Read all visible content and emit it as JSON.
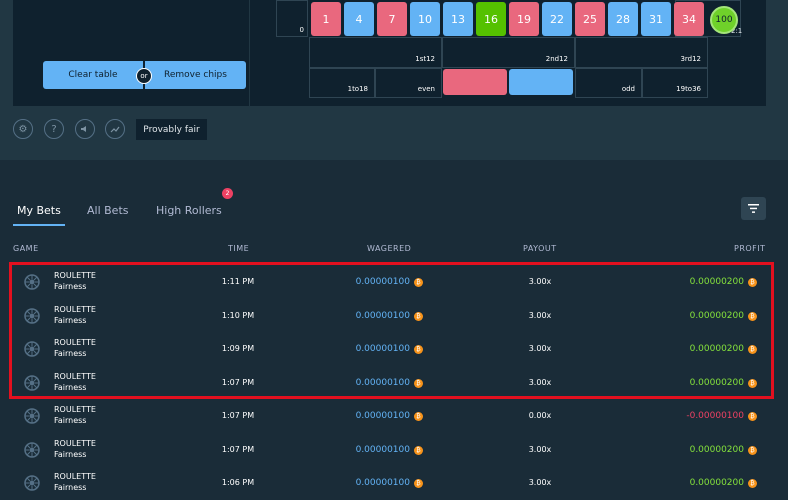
{
  "controls": {
    "clear_table": "Clear table",
    "or": "or",
    "remove_chips": "Remove chips",
    "provably_fair": "Provably fair"
  },
  "board": {
    "zero": "0",
    "numbers": [
      {
        "value": "1",
        "color": "red"
      },
      {
        "value": "4",
        "color": "blue"
      },
      {
        "value": "7",
        "color": "red"
      },
      {
        "value": "10",
        "color": "blue"
      },
      {
        "value": "13",
        "color": "blue"
      },
      {
        "value": "16",
        "color": "green"
      },
      {
        "value": "19",
        "color": "red"
      },
      {
        "value": "22",
        "color": "blue"
      },
      {
        "value": "25",
        "color": "red"
      },
      {
        "value": "28",
        "color": "blue"
      },
      {
        "value": "31",
        "color": "blue"
      },
      {
        "value": "34",
        "color": "red"
      }
    ],
    "column_suffix": "2:1",
    "dozens": [
      "1st12",
      "2nd12",
      "3rd12"
    ],
    "outside": [
      "1to18",
      "even",
      "",
      "",
      "odd",
      "19to36"
    ],
    "chip_value": "100"
  },
  "colors": {
    "red": "#e9687e",
    "blue": "#63b3f5",
    "green": "#55c100",
    "profit_positive": "#84e13c",
    "profit_negative": "#ed4163",
    "highlight": "#e3101f"
  },
  "tabs": {
    "my_bets": "My Bets",
    "all_bets": "All Bets",
    "high_rollers": "High Rollers",
    "high_rollers_badge": "2"
  },
  "table": {
    "headers": [
      "GAME",
      "TIME",
      "WAGERED",
      "PAYOUT",
      "PROFIT"
    ],
    "rows": [
      {
        "game": "ROULETTE",
        "sub": "Fairness",
        "time": "1:11 PM",
        "wagered": "0.00000100",
        "payout": "3.00x",
        "profit": "0.00000200",
        "win": true
      },
      {
        "game": "ROULETTE",
        "sub": "Fairness",
        "time": "1:10 PM",
        "wagered": "0.00000100",
        "payout": "3.00x",
        "profit": "0.00000200",
        "win": true
      },
      {
        "game": "ROULETTE",
        "sub": "Fairness",
        "time": "1:09 PM",
        "wagered": "0.00000100",
        "payout": "3.00x",
        "profit": "0.00000200",
        "win": true
      },
      {
        "game": "ROULETTE",
        "sub": "Fairness",
        "time": "1:07 PM",
        "wagered": "0.00000100",
        "payout": "3.00x",
        "profit": "0.00000200",
        "win": true
      },
      {
        "game": "ROULETTE",
        "sub": "Fairness",
        "time": "1:07 PM",
        "wagered": "0.00000100",
        "payout": "0.00x",
        "profit": "-0.00000100",
        "win": false
      },
      {
        "game": "ROULETTE",
        "sub": "Fairness",
        "time": "1:07 PM",
        "wagered": "0.00000100",
        "payout": "3.00x",
        "profit": "0.00000200",
        "win": true
      },
      {
        "game": "ROULETTE",
        "sub": "Fairness",
        "time": "1:06 PM",
        "wagered": "0.00000100",
        "payout": "3.00x",
        "profit": "0.00000200",
        "win": true
      }
    ]
  }
}
